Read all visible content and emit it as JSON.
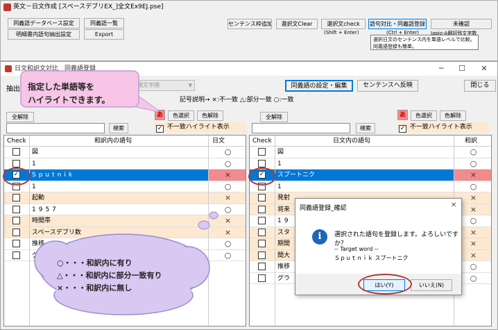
{
  "main_window": {
    "title": "英文－日文作成 [スペースデブリEX_]全文Ex9EJ.pse]",
    "buttons": {
      "synonym_db": "同義語データベース設定",
      "synonym_list": "同義語一覧",
      "specification": "明細書内語句抽出設定",
      "export": "Export",
      "sentence_add": "センテンス枠追加",
      "select_clear": "選択文Clear",
      "select_check": "選択文check",
      "select_check_hint": "(Shift + Enter)",
      "phrase_compare": "語句対比・同義語登録",
      "phrase_compare_hint": "(Ctrl + Enter)",
      "unconfirmed": "未確認",
      "japio": "Japio-A翻訳残文字数"
    },
    "tooltip": [
      "選択日文のセンテンス内を単語レベルで比較。",
      "同義語登録も簡単。"
    ]
  },
  "child_window": {
    "title": "日文和訳文対比　同義語登録",
    "extract_label": "抽出",
    "sort_label": "先頭文字順",
    "synonym_settings": "同義語の設定・編集",
    "reflect_sentence": "センテンスへ反映",
    "close": "閉じる",
    "legend": "記号説明→ ×:不一致 △:部分一致 ○:一致",
    "left": {
      "select_all": "全解除",
      "search": "検索",
      "color_a": "あ",
      "color_select": "色選択",
      "color_clear": "色解除",
      "highlight": "不一致ハイライト表示",
      "col_check": "Check",
      "col_phrase": "和訳内の語句",
      "col_match": "日文",
      "rows": [
        {
          "text": "図",
          "mark": "○",
          "checked": false,
          "style": "white"
        },
        {
          "text": "1",
          "mark": "○",
          "checked": false,
          "style": "white"
        },
        {
          "text": "Sputnik",
          "mark": "×",
          "checked": true,
          "style": "sel"
        },
        {
          "text": "1",
          "mark": "○",
          "checked": false,
          "style": "white"
        },
        {
          "text": "起動",
          "mark": "×",
          "checked": false,
          "style": "orange"
        },
        {
          "text": "1957",
          "mark": "○",
          "checked": false,
          "style": "white"
        },
        {
          "text": "時間帯",
          "mark": "×",
          "checked": false,
          "style": "orange"
        },
        {
          "text": "スペースデブリ数",
          "mark": "×",
          "checked": false,
          "style": "orange"
        },
        {
          "text": "推移",
          "mark": "○",
          "checked": false,
          "style": "white"
        },
        {
          "text": "グラ",
          "mark": "○",
          "checked": false,
          "style": "white"
        }
      ]
    },
    "right": {
      "select_all": "全解除",
      "search": "検索",
      "color_a": "あ",
      "color_select": "色選択",
      "color_clear": "色解除",
      "highlight": "不一致ハイライト表示",
      "col_check": "Check",
      "col_phrase": "日文内の語句",
      "col_match": "和訳",
      "rows": [
        {
          "text": "図",
          "mark": "○",
          "checked": false,
          "style": "white"
        },
        {
          "text": "1",
          "mark": "○",
          "checked": false,
          "style": "white"
        },
        {
          "text": "スプートニク",
          "mark": "×",
          "checked": true,
          "style": "sel"
        },
        {
          "text": "1",
          "mark": "○",
          "checked": false,
          "style": "white"
        },
        {
          "text": "発射",
          "mark": "×",
          "checked": false,
          "style": "orange"
        },
        {
          "text": "将来",
          "mark": "×",
          "checked": false,
          "style": "orange"
        },
        {
          "text": "19",
          "mark": "○",
          "checked": false,
          "style": "white"
        },
        {
          "text": "スタ",
          "mark": "×",
          "checked": false,
          "style": "orange"
        },
        {
          "text": "期間",
          "mark": "×",
          "checked": false,
          "style": "orange"
        },
        {
          "text": "間大",
          "mark": "×",
          "checked": false,
          "style": "orange"
        },
        {
          "text": "推移",
          "mark": "○",
          "checked": false,
          "style": "white"
        },
        {
          "text": "グラ",
          "mark": "○",
          "checked": false,
          "style": "white"
        }
      ]
    }
  },
  "dialog": {
    "title": "同義語登録_確認",
    "message": "選択された語句を登録します。よろしいですか？",
    "target_label": "-- Target word --",
    "target_value": "Ｓｐｕｔｎｉｋ スプートニク",
    "yes": "はい(Y)",
    "no": "いいえ(N)"
  },
  "callout_top": [
    "指定した単語等を",
    "ハイライトできます。"
  ],
  "callout_bottom": [
    "○・・・和訳内に有り",
    "△・・・和訳内に部分一致有り",
    "×・・・和訳内に無し"
  ],
  "colors": {
    "accent": "#0078d7",
    "mismatch": "#fde9d2",
    "highlight_red": "#c0392b",
    "callout_pink": "#f7c6e6",
    "callout_purple": "#d9c8f2"
  }
}
